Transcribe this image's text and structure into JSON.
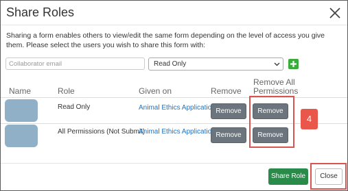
{
  "dialog": {
    "title": "Share Roles",
    "description": "Sharing a form enables others to view/edit the same form depending on the level of access you give them. Please select the users you wish to share this form with:"
  },
  "form": {
    "email_placeholder": "Collaborator email",
    "access_selected": "Read Only"
  },
  "table": {
    "headers": {
      "name": "Name",
      "role": "Role",
      "given_on": "Given on",
      "remove": "Remove",
      "remove_all": "Remove All Permissions"
    },
    "rows": [
      {
        "role": "Read Only",
        "given_on": "Animal Ethics Application",
        "remove": "Remove",
        "remove_all": "Remove"
      },
      {
        "role": "All Permissions (Not Submit)",
        "given_on": "Animal Ethics Application",
        "remove": "Remove",
        "remove_all": "Remove"
      }
    ]
  },
  "annotation": {
    "badge": "4"
  },
  "footer": {
    "share_label": "Share Role",
    "close_label": "Close"
  },
  "colors": {
    "add_button": "#3bab3b",
    "share_button": "#2a8a4a",
    "remove_button": "#6c757d",
    "highlight": "#d9534f",
    "link": "#1a73c6"
  },
  "icons": {
    "close": "close-icon",
    "add": "plus-icon",
    "dropdown": "chevron-down-icon"
  }
}
